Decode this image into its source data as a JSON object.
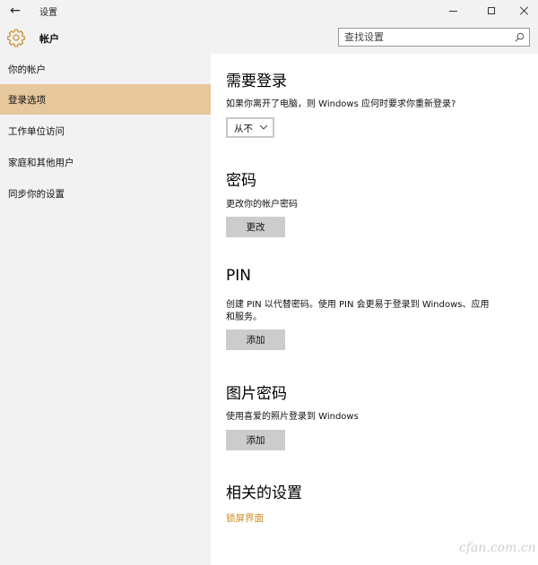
{
  "window": {
    "title": "设置",
    "back_glyph": "←"
  },
  "header": {
    "title": "帐户",
    "icon": "gear-icon",
    "search_placeholder": "查找设置"
  },
  "sidebar": {
    "items": [
      {
        "label": "你的帐户",
        "selected": false
      },
      {
        "label": "登录选项",
        "selected": true
      },
      {
        "label": "工作单位访问",
        "selected": false
      },
      {
        "label": "家庭和其他用户",
        "selected": false
      },
      {
        "label": "同步你的设置",
        "selected": false
      }
    ]
  },
  "content": {
    "require_signin": {
      "heading": "需要登录",
      "description": "如果你离开了电脑，则 Windows 应何时要求你重新登录?",
      "dropdown_value": "从不"
    },
    "password": {
      "heading": "密码",
      "description": "更改你的帐户密码",
      "button": "更改"
    },
    "pin": {
      "heading": "PIN",
      "description_line1": "创建 PIN 以代替密码。使用 PIN 会更易于登录到 Windows、应用",
      "description_line2": "和服务。",
      "button": "添加"
    },
    "picture_password": {
      "heading": "图片密码",
      "description": "使用喜爱的照片登录到 Windows",
      "button": "添加"
    },
    "related": {
      "heading": "相关的设置",
      "link": "锁屏界面"
    }
  },
  "watermark": "cfan.com.cn",
  "colors": {
    "accent": "#c98b2a",
    "selected_nav": "#e7c79c",
    "sidebar_bg": "#f2f2f2",
    "button_bg": "#cccccc"
  }
}
